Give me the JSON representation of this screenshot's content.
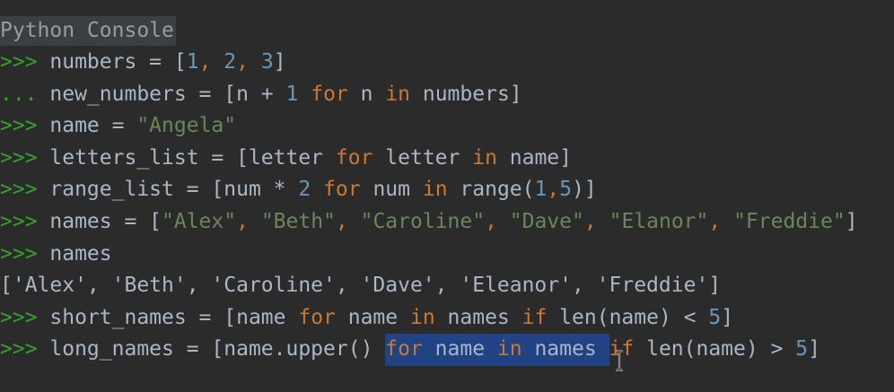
{
  "panel": {
    "title": "Python Console"
  },
  "lines": [
    {
      "prompt": ">>> ",
      "tokens": [
        {
          "t": "numbers = [",
          "c": "op"
        },
        {
          "t": "1",
          "c": "num"
        },
        {
          "t": ", ",
          "c": "kw"
        },
        {
          "t": "2",
          "c": "num"
        },
        {
          "t": ", ",
          "c": "kw"
        },
        {
          "t": "3",
          "c": "num"
        },
        {
          "t": "]",
          "c": "op"
        }
      ]
    },
    {
      "prompt": "... ",
      "prompt_class": "cont",
      "tokens": [
        {
          "t": "new_numbers = [n + ",
          "c": "op"
        },
        {
          "t": "1",
          "c": "num"
        },
        {
          "t": " ",
          "c": "op"
        },
        {
          "t": "for",
          "c": "kw"
        },
        {
          "t": " n ",
          "c": "op"
        },
        {
          "t": "in",
          "c": "kw"
        },
        {
          "t": " numbers]",
          "c": "op"
        }
      ]
    },
    {
      "prompt": ">>> ",
      "tokens": [
        {
          "t": "name = ",
          "c": "op"
        },
        {
          "t": "\"Angela\"",
          "c": "str"
        }
      ]
    },
    {
      "prompt": ">>> ",
      "tokens": [
        {
          "t": "letters_list = [letter ",
          "c": "op"
        },
        {
          "t": "for",
          "c": "kw"
        },
        {
          "t": " letter ",
          "c": "op"
        },
        {
          "t": "in",
          "c": "kw"
        },
        {
          "t": " name]",
          "c": "op"
        }
      ]
    },
    {
      "prompt": ">>> ",
      "tokens": [
        {
          "t": "range_list = [num * ",
          "c": "op"
        },
        {
          "t": "2",
          "c": "num"
        },
        {
          "t": " ",
          "c": "op"
        },
        {
          "t": "for",
          "c": "kw"
        },
        {
          "t": " num ",
          "c": "op"
        },
        {
          "t": "in",
          "c": "kw"
        },
        {
          "t": " range(",
          "c": "op"
        },
        {
          "t": "1",
          "c": "num"
        },
        {
          "t": ",",
          "c": "kw"
        },
        {
          "t": "5",
          "c": "num"
        },
        {
          "t": ")]",
          "c": "op"
        }
      ]
    },
    {
      "prompt": ">>> ",
      "tokens": [
        {
          "t": "names = [",
          "c": "op"
        },
        {
          "t": "\"Alex\"",
          "c": "str"
        },
        {
          "t": ", ",
          "c": "kw"
        },
        {
          "t": "\"Beth\"",
          "c": "str"
        },
        {
          "t": ", ",
          "c": "kw"
        },
        {
          "t": "\"Caroline\"",
          "c": "str"
        },
        {
          "t": ", ",
          "c": "kw"
        },
        {
          "t": "\"Dave\"",
          "c": "str"
        },
        {
          "t": ", ",
          "c": "kw"
        },
        {
          "t": "\"Elanor\"",
          "c": "str"
        },
        {
          "t": ", ",
          "c": "kw"
        },
        {
          "t": "\"Freddie\"",
          "c": "str"
        },
        {
          "t": "]",
          "c": "op"
        }
      ]
    },
    {
      "prompt": ">>> ",
      "tokens": [
        {
          "t": "names",
          "c": "op"
        }
      ]
    },
    {
      "prompt": "",
      "tokens": [
        {
          "t": "['Alex', 'Beth', 'Caroline', 'Dave', 'Eleanor', 'Freddie']",
          "c": "op"
        }
      ]
    },
    {
      "prompt": ">>> ",
      "tokens": [
        {
          "t": "short_names = [name ",
          "c": "op"
        },
        {
          "t": "for",
          "c": "kw"
        },
        {
          "t": " name ",
          "c": "op"
        },
        {
          "t": "in",
          "c": "kw"
        },
        {
          "t": " names ",
          "c": "op"
        },
        {
          "t": "if",
          "c": "kw"
        },
        {
          "t": " len(name) < ",
          "c": "op"
        },
        {
          "t": "5",
          "c": "num"
        },
        {
          "t": "]",
          "c": "op"
        }
      ]
    },
    {
      "prompt": ">>> ",
      "tokens": [
        {
          "t": "long_names = [name.upper() ",
          "c": "op"
        },
        {
          "t": "for",
          "c": "kw",
          "sel": true
        },
        {
          "t": " name ",
          "c": "op",
          "sel": true
        },
        {
          "t": "in",
          "c": "kw",
          "sel": true
        },
        {
          "t": " names ",
          "c": "op",
          "sel": true
        },
        {
          "t": "if",
          "c": "kw"
        },
        {
          "t": " len(name) > ",
          "c": "op"
        },
        {
          "t": "5",
          "c": "num"
        },
        {
          "t": "]",
          "c": "op"
        }
      ]
    }
  ],
  "cursor": {
    "icon": "text-cursor-icon"
  },
  "colors": {
    "background": "#2b2b2b",
    "prompt": "#37a12b",
    "keyword": "#cc7832",
    "number": "#6897bb",
    "string": "#6a8759",
    "selection": "#214283"
  }
}
